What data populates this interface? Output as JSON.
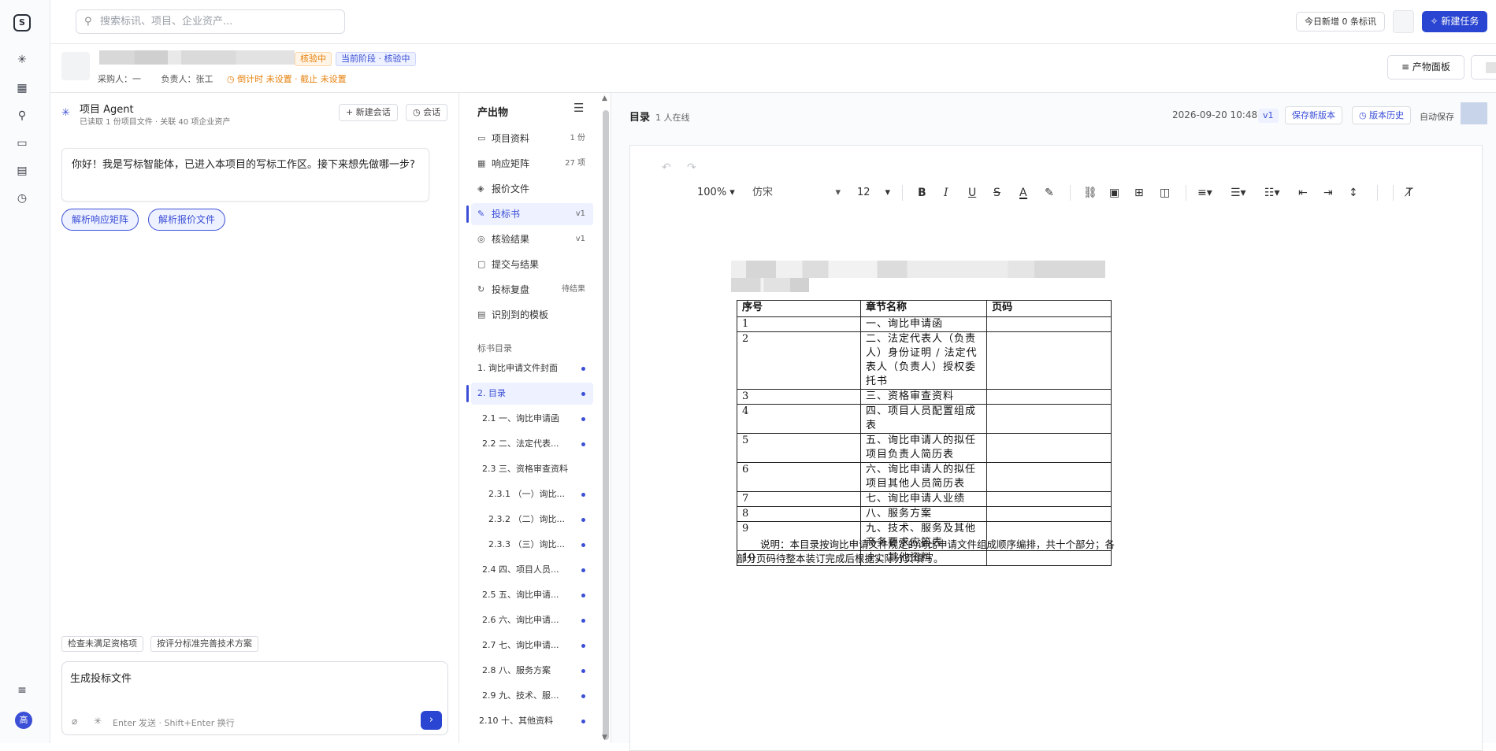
{
  "search": {
    "placeholder": "搜索标讯、项目、企业资产..."
  },
  "topbar": {
    "today_label": "今日新增 0 条标讯",
    "new_task_label": "新建任务"
  },
  "user": {
    "avatar_label": "高"
  },
  "project": {
    "status_tag": "核验中",
    "stage_tag": "当前阶段 · 核验中",
    "buyer_label": "采购人：一",
    "owner_label": "负责人：张工",
    "countdown_label": "倒计时 未设置 · 截止 未设置",
    "board_button": "产物面板"
  },
  "agent": {
    "title": "项目 Agent",
    "subtitle": "已读取 1 份项目文件 · 关联 40 项企业资产",
    "new_session": "新建会话",
    "sessions": "会话",
    "greeting": "你好！我是写标智能体，已进入本项目的写标工作区。接下来想先做哪一步?",
    "chips": [
      "解析响应矩阵",
      "解析报价文件"
    ],
    "hints": [
      "检查未满足资格项",
      "按评分标准完善技术方案"
    ],
    "composer_text": "生成投标文件",
    "composer_hint": "Enter 发送 · Shift+Enter 换行"
  },
  "artifacts": {
    "title": "产出物",
    "items": [
      {
        "icon": "folder-icon",
        "label": "项目资料",
        "count": "1 份"
      },
      {
        "icon": "matrix-icon",
        "label": "响应矩阵",
        "count": "27 项"
      },
      {
        "icon": "layers-icon",
        "label": "报价文件",
        "count": ""
      },
      {
        "icon": "pen-icon",
        "label": "投标书",
        "count": "v1"
      },
      {
        "icon": "check-circle-icon",
        "label": "核验结果",
        "count": "v1"
      },
      {
        "icon": "clipboard-icon",
        "label": "提交与结果",
        "count": ""
      },
      {
        "icon": "refresh-icon",
        "label": "投标复盘",
        "count": "待结果"
      },
      {
        "icon": "document-icon",
        "label": "识别到的模板",
        "count": ""
      }
    ],
    "toc_title": "标书目录",
    "toc": [
      "1. 询比申请文件封面",
      "2. 目录",
      "2.1 一、询比申请函",
      "2.2 二、法定代表...",
      "2.3 三、资格审查资料",
      "2.3.1 （一）询比...",
      "2.3.2 （二）询比...",
      "2.3.3 （三）询比...",
      "2.4 四、项目人员...",
      "2.5 五、询比申请...",
      "2.6 六、询比申请...",
      "2.7 七、询比申请...",
      "2.8 八、服务方案",
      "2.9 九、技术、服...",
      "2.10 十、其他资料"
    ]
  },
  "editor": {
    "title": "目录",
    "online": "1 人在线",
    "datetime": "2026-09-20 10:48",
    "version": "v1",
    "save_version": "保存新版本",
    "history": "版本历史",
    "autosave": "自动保存",
    "toolbar": {
      "zoom": "100%",
      "font": "仿宋",
      "size": "12"
    },
    "table": {
      "headers": [
        "序号",
        "章节名称",
        "页码"
      ],
      "rows": [
        [
          "1",
          "一、询比申请函",
          ""
        ],
        [
          "2",
          "二、法定代表人（负责人）身份证明 / 法定代表人（负责人）授权委托书",
          ""
        ],
        [
          "3",
          "三、资格审查资料",
          ""
        ],
        [
          "4",
          "四、项目人员配置组成表",
          ""
        ],
        [
          "5",
          "五、询比申请人的拟任项目负责人简历表",
          ""
        ],
        [
          "6",
          "六、询比申请人的拟任项目其他人员简历表",
          ""
        ],
        [
          "7",
          "七、询比申请人业绩",
          ""
        ],
        [
          "8",
          "八、服务方案",
          ""
        ],
        [
          "9",
          "九、技术、服务及其他商务要求应答表",
          ""
        ],
        [
          "10",
          "十、其他资料",
          ""
        ]
      ]
    },
    "note": "说明：本目录按询比申请文件规定的询比申请文件组成顺序编排，共十个部分；各部分页码待整本装订完成后根据实际分页填写。"
  }
}
